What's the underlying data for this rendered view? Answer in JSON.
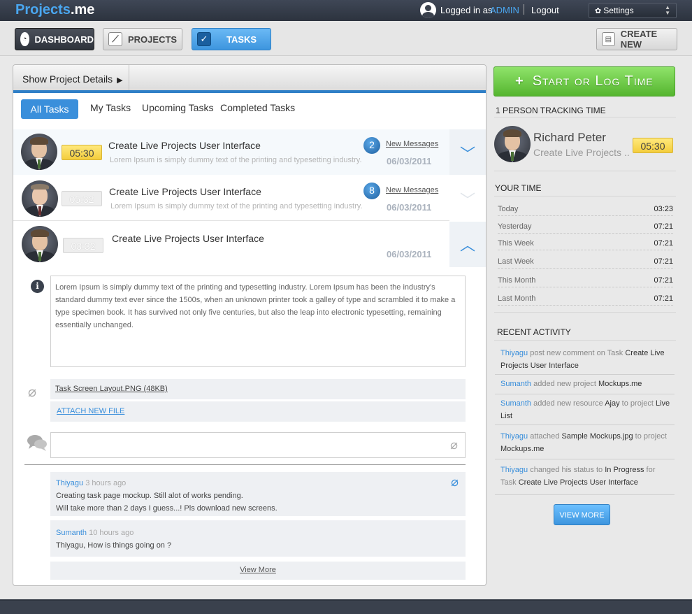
{
  "header": {
    "logo_part1": "Projects",
    "logo_part2": ".me",
    "logged_in_as": "Logged in as",
    "username": "ADMIN",
    "logout": "Logout",
    "settings": "Settings"
  },
  "nav": {
    "dashboard": "DASHBOARD",
    "projects": "PROJECTS",
    "tasks": "TASKS",
    "create_new": "CREATE NEW"
  },
  "panel": {
    "show_details": "Show Project Details",
    "tabs": [
      "All Tasks",
      "My Tasks",
      "Upcoming Tasks",
      "Completed Tasks"
    ],
    "active_tab": "All Tasks"
  },
  "tasks": [
    {
      "time": "05:30",
      "title": "Create Live Projects User Interface",
      "desc": "Lorem Ipsum is simply dummy text of the printing and typesetting industry.",
      "msg_count": "2",
      "msg_label": "New Messages",
      "date": "06/03/2011",
      "running": true
    },
    {
      "time": "05:32",
      "title": "Create Live Projects User Interface",
      "desc": "Lorem Ipsum is simply dummy text of the printing and typesetting industry.",
      "msg_count": "8",
      "msg_label": "New Messages",
      "date": "06/03/2011",
      "running": false
    },
    {
      "time": "03:32",
      "title": "Create Live Projects User Interface",
      "date": "06/03/2011",
      "running": false
    }
  ],
  "detail": {
    "description": "Lorem Ipsum is simply dummy text of the printing and typesetting industry. Lorem Ipsum has been the industry's standard dummy text ever since the 1500s, when an unknown printer took a galley of type and scrambled it to make a type specimen book. It has survived not only five centuries, but also the leap into electronic typesetting, remaining essentially unchanged.",
    "attachment": "Task Screen Layout.PNG (48KB)",
    "attach_new": "ATTACH NEW FILE",
    "comments": [
      {
        "author": "Thiyagu",
        "time": "3 hours ago",
        "lines": [
          "Creating task page mockup. Still alot of works pending.",
          "Will take more than 2 days I guess...! Pls download new screens."
        ]
      },
      {
        "author": "Sumanth",
        "time": "10 hours ago",
        "lines": [
          "Thiyagu, How is things going on ?"
        ]
      }
    ],
    "view_more": "View More"
  },
  "sidebar": {
    "start_button": "Start or Log Time",
    "tracking_heading": "1 PERSON TRACKING TIME",
    "tracker": {
      "name": "Richard Peter",
      "task": "Create Live Projects ..",
      "time": "05:30"
    },
    "your_time_heading": "YOUR TIME",
    "your_time": [
      {
        "label": "Today",
        "value": "03:23"
      },
      {
        "label": "Yesterday",
        "value": "07:21"
      },
      {
        "label": "This Week",
        "value": "07:21"
      },
      {
        "label": "Last Week",
        "value": "07:21"
      },
      {
        "label": "This Month",
        "value": "07:21"
      },
      {
        "label": "Last Month",
        "value": "07:21"
      }
    ],
    "activity_heading": "RECENT ACTIVITY",
    "activity": [
      {
        "user": "Thiyagu",
        "action": " post new comment on Task ",
        "object": "Create Live Projects User Interface",
        "extra": "",
        "target": ""
      },
      {
        "user": "Sumanth",
        "action": " added new project ",
        "object": "Mockups.me",
        "extra": "",
        "target": ""
      },
      {
        "user": "Sumanth",
        "action": " added new resource ",
        "object": "Ajay",
        "extra": " to project ",
        "target": " Live List"
      },
      {
        "user": "Thiyagu",
        "action": " attached ",
        "object": "Sample Mockups.jpg",
        "extra": " to project ",
        "target": "Mockups.me"
      },
      {
        "user": "Thiyagu",
        "action": " changed his status to ",
        "object": "In Progress",
        "extra": " for Task ",
        "target": "Create Live Projects User Interface"
      }
    ],
    "view_more": "VIEW MORE"
  },
  "colors": {
    "accent": "#3a8fdb",
    "topbar": "#2c333e",
    "start_green": "#55b52f",
    "timer_yellow": "#f4cd3c"
  }
}
